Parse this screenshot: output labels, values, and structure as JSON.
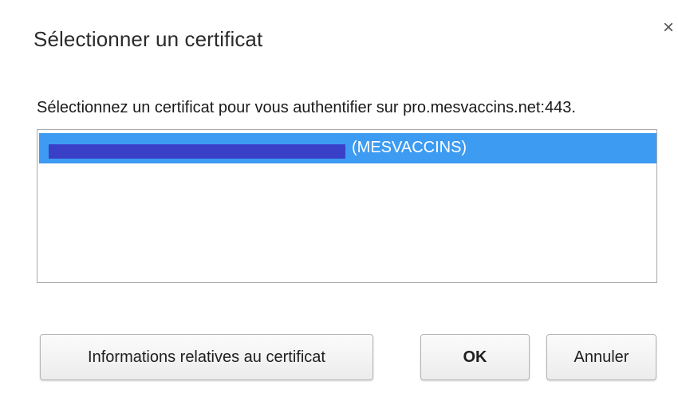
{
  "dialog": {
    "title": "Sélectionner un certificat",
    "close_glyph": "×",
    "prompt": "Sélectionnez un certificat pour vous authentifier sur pro.mesvaccins.net:443."
  },
  "certificates": [
    {
      "label": "(MESVACCINS)",
      "selected": true
    }
  ],
  "buttons": {
    "info_label": "Informations relatives au certificat",
    "ok_label": "OK",
    "cancel_label": "Annuler"
  },
  "colors": {
    "selection": "#3d9bf2",
    "redaction": "#3a3fc8"
  }
}
